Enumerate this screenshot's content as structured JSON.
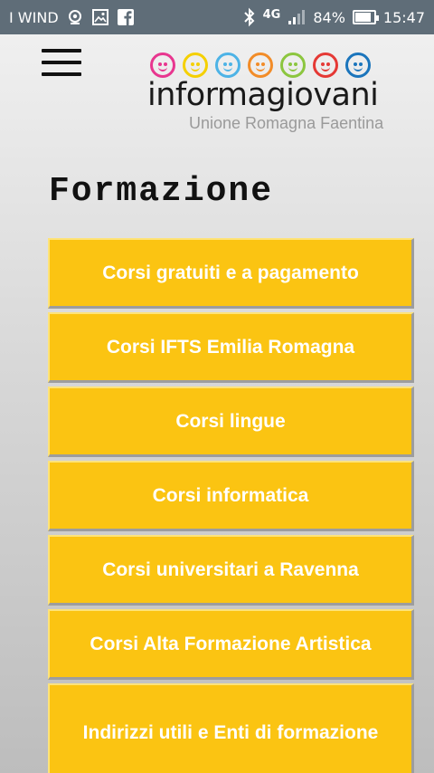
{
  "status_bar": {
    "carrier": "I WIND",
    "network": "4G",
    "battery_percent": "84%",
    "battery_level": 0.84,
    "time": "15:47",
    "icons_left": [
      "location-icon",
      "image-icon",
      "facebook-icon"
    ],
    "icons_right": [
      "bluetooth-icon",
      "signal-icon",
      "battery-icon"
    ],
    "background_color": "#5f6d78"
  },
  "header": {
    "menu_icon": "hamburger-menu-icon",
    "logo": {
      "wordmark": "informagiovani",
      "subtitle": "Unione Romagna Faentina",
      "face_colors": [
        "#e8368f",
        "#f5d000",
        "#4db3e6",
        "#f28c28",
        "#8cc63f",
        "#e53935",
        "#1b75bc"
      ]
    }
  },
  "page": {
    "title": "Formazione"
  },
  "menu_items": [
    {
      "label": "Corsi gratuiti e a pagamento"
    },
    {
      "label": "Corsi IFTS Emilia Romagna"
    },
    {
      "label": "Corsi lingue"
    },
    {
      "label": "Corsi informatica"
    },
    {
      "label": "Corsi universitari a Ravenna"
    },
    {
      "label": "Corsi Alta Formazione Artistica"
    },
    {
      "label": "Indirizzi utili e Enti di formazione"
    }
  ],
  "colors": {
    "button_background": "#fbc412",
    "button_text": "#ffffff",
    "title_text": "#111111"
  }
}
